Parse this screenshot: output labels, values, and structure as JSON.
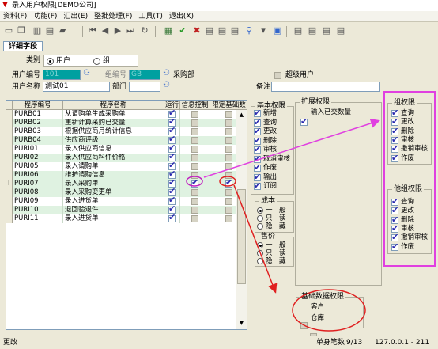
{
  "window": {
    "title": "录入用户权限[DEMO公司]"
  },
  "menu": [
    "资料(F)",
    "功能(F)",
    "汇出(E)",
    "整批处理(F)",
    "工具(T)",
    "退出(X)"
  ],
  "tab": "详细字段",
  "form": {
    "type_label": "类别",
    "type_user": "用户",
    "type_group": "组",
    "user_code_label": "用户编号",
    "user_code_value": "101",
    "group_code_label": "组编号",
    "group_code_value": "GB",
    "group_name": "采购部",
    "super_user_label": "超级用户",
    "user_name_label": "用户名称",
    "user_name_value": "测试01",
    "dept_label": "部门",
    "remark_label": "备注"
  },
  "grid": {
    "headers": [
      "程序编号",
      "程序名称",
      "运行",
      "信息控制",
      "限定基础数"
    ],
    "rows": [
      {
        "code": "PURB01",
        "name": "从请购单生成采购单",
        "run": true,
        "info": false,
        "limit": false
      },
      {
        "code": "PURB02",
        "name": "重新计算采购已交量",
        "run": true,
        "info": false,
        "limit": false
      },
      {
        "code": "PURB03",
        "name": "根据供应商月统计信息",
        "run": true,
        "info": false,
        "limit": false
      },
      {
        "code": "PURB04",
        "name": "供应商评级",
        "run": true,
        "info": false,
        "limit": false
      },
      {
        "code": "PURI01",
        "name": "录入供应商信息",
        "run": true,
        "info": false,
        "limit": false
      },
      {
        "code": "PURI02",
        "name": "录入供应商料件价格",
        "run": true,
        "info": false,
        "limit": false
      },
      {
        "code": "PURI05",
        "name": "录入请购单",
        "run": true,
        "info": false,
        "limit": false
      },
      {
        "code": "PURI06",
        "name": "维护请购信息",
        "run": true,
        "info": false,
        "limit": false
      },
      {
        "code": "PURI07",
        "name": "录入采购单",
        "run": true,
        "info": true,
        "limit": true
      },
      {
        "code": "PURI08",
        "name": "录入采购变更单",
        "run": true,
        "info": false,
        "limit": false
      },
      {
        "code": "PURI09",
        "name": "录入进货单",
        "run": true,
        "info": false,
        "limit": false
      },
      {
        "code": "PURI10",
        "name": "退回验退件",
        "run": true,
        "info": false,
        "limit": false
      },
      {
        "code": "PURI11",
        "name": "录入进货单",
        "run": true,
        "info": false,
        "limit": false
      }
    ]
  },
  "basic_perm": {
    "title": "基本权限",
    "items": [
      "新增",
      "查询",
      "更改",
      "删除",
      "审核",
      "取消审核",
      "作废",
      "输出",
      "订阅"
    ]
  },
  "ext_perm": {
    "title": "扩展权限",
    "items": [
      "输入已交数量"
    ]
  },
  "cost": {
    "title": "成本",
    "options": [
      "一　般",
      "只　读",
      "隐　藏"
    ]
  },
  "price": {
    "title": "售价",
    "options": [
      "一　般",
      "只　读",
      "隐　藏"
    ]
  },
  "basedata": {
    "title": "基础数据权限",
    "items": [
      "客户",
      "仓库"
    ]
  },
  "group_perm": {
    "title": "组权限",
    "items": [
      "查询",
      "更改",
      "删除",
      "审核",
      "撤销审核",
      "作废"
    ]
  },
  "other_group_perm": {
    "title": "他组权限",
    "items": [
      "查询",
      "更改",
      "删除",
      "审核",
      "撤销审核",
      "作废"
    ]
  },
  "status": {
    "left": "更改",
    "mode_label": "单身笔数",
    "count": "9/13",
    "ip": "127.0.0.1 - 211"
  },
  "colors": {
    "annotation": "#e040e0",
    "highlight": "#e02020",
    "check": "#2b2bb0"
  }
}
